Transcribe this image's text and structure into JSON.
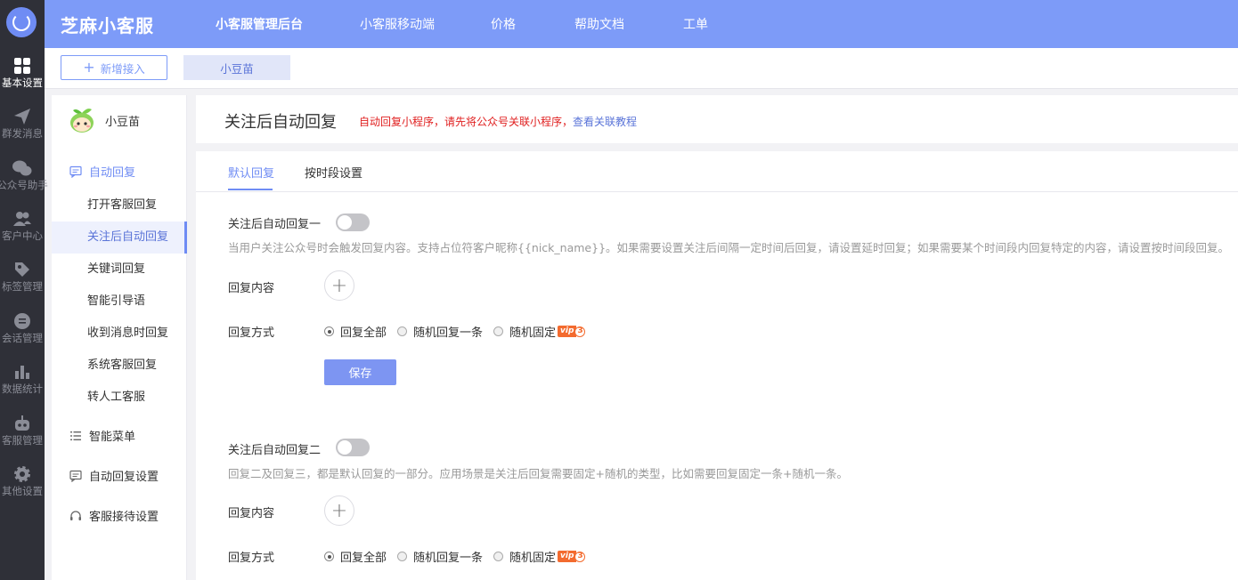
{
  "rail": {
    "items": [
      {
        "label": "基本设置",
        "icon": "grid-icon"
      },
      {
        "label": "群发消息",
        "icon": "send-icon"
      },
      {
        "label": "公众号助手",
        "icon": "wechat-icon"
      },
      {
        "label": "客户中心",
        "icon": "users-icon"
      },
      {
        "label": "标签管理",
        "icon": "tag-icon"
      },
      {
        "label": "会话管理",
        "icon": "chat-icon"
      },
      {
        "label": "数据统计",
        "icon": "bar-chart-icon"
      },
      {
        "label": "客服管理",
        "icon": "robot-icon"
      },
      {
        "label": "其他设置",
        "icon": "gear-icon"
      }
    ]
  },
  "topbar": {
    "brand": "芝麻小客服",
    "nav": [
      "小客服管理后台",
      "小客服移动端",
      "价格",
      "帮助文档",
      "工单"
    ]
  },
  "subbar": {
    "add_label": "新增接入",
    "account_tab": "小豆苗"
  },
  "side": {
    "account_name": "小豆苗",
    "auto_reply": "自动回复",
    "sub_items": [
      "打开客服回复",
      "关注后自动回复",
      "关键词回复",
      "智能引导语",
      "收到消息时回复",
      "系统客服回复",
      "转人工客服"
    ],
    "smart_menu": "智能菜单",
    "auto_reply_settings": "自动回复设置",
    "service_settings": "客服接待设置"
  },
  "title_panel": {
    "title": "关注后自动回复",
    "warning": "自动回复小程序，请先将公众号关联小程序，",
    "link": "查看关联教程"
  },
  "tabs": [
    "默认回复",
    "按时段设置"
  ],
  "section1": {
    "label": "关注后自动回复一",
    "hint": "当用户关注公众号时会触发回复内容。支持占位符客户昵称{{nick_name}}。如果需要设置关注后间隔一定时间后回复，请设置延时回复；如果需要某个时间段内回复特定的内容，请设置按时间段回复。",
    "content_label": "回复内容",
    "mode_label": "回复方式",
    "options": [
      "回复全部",
      "随机回复一条",
      "随机固定"
    ],
    "save": "保存"
  },
  "section2": {
    "label": "关注后自动回复二",
    "hint": "回复二及回复三，都是默认回复的一部分。应用场景是关注后回复需要固定+随机的类型，比如需要回复固定一条+随机一条。",
    "content_label": "回复内容",
    "mode_label": "回复方式",
    "options": [
      "回复全部",
      "随机回复一条",
      "随机固定"
    ]
  },
  "vip": {
    "text": "vip",
    "level": "3"
  }
}
